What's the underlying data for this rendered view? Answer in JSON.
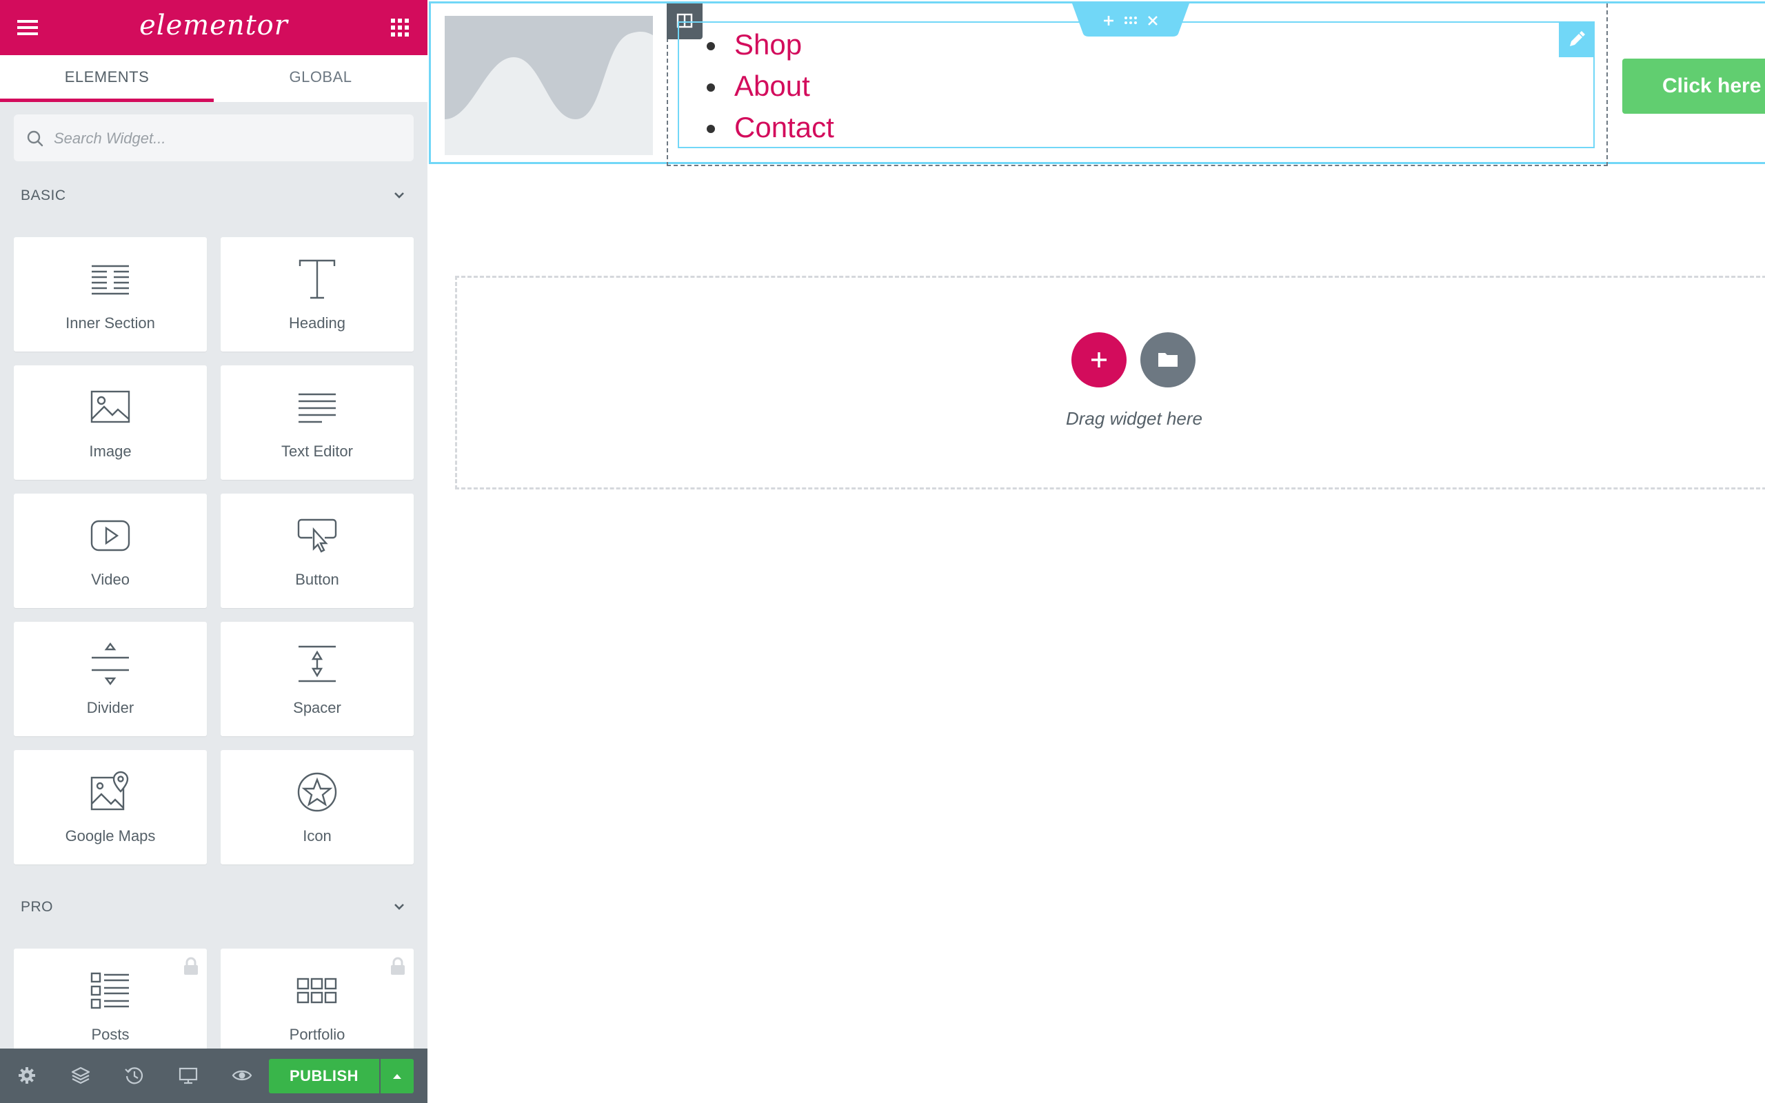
{
  "app": {
    "logo_text": "elementor",
    "brand_color": "#d30c5c",
    "accent_color": "#71d7f7",
    "publish_color": "#39b54a"
  },
  "header_icons": {
    "menu": "hamburger-menu-icon",
    "apps": "apps-grid-icon"
  },
  "tabs": [
    {
      "label": "ELEMENTS",
      "active": true
    },
    {
      "label": "GLOBAL",
      "active": false
    }
  ],
  "search": {
    "placeholder": "Search Widget..."
  },
  "categories": {
    "basic": {
      "title": "BASIC",
      "widgets": [
        {
          "label": "Inner Section",
          "icon": "inner-section-icon"
        },
        {
          "label": "Heading",
          "icon": "heading-icon"
        },
        {
          "label": "Image",
          "icon": "image-icon"
        },
        {
          "label": "Text Editor",
          "icon": "text-editor-icon"
        },
        {
          "label": "Video",
          "icon": "video-icon"
        },
        {
          "label": "Button",
          "icon": "button-icon"
        },
        {
          "label": "Divider",
          "icon": "divider-icon"
        },
        {
          "label": "Spacer",
          "icon": "spacer-icon"
        },
        {
          "label": "Google Maps",
          "icon": "google-maps-icon"
        },
        {
          "label": "Icon",
          "icon": "star-icon"
        }
      ]
    },
    "pro": {
      "title": "PRO",
      "widgets": [
        {
          "label": "Posts",
          "icon": "posts-icon",
          "locked": true
        },
        {
          "label": "Portfolio",
          "icon": "portfolio-icon",
          "locked": true
        }
      ]
    }
  },
  "footer": {
    "publish_label": "PUBLISH",
    "icons": [
      "settings-icon",
      "navigator-layers-icon",
      "history-icon",
      "responsive-desktop-icon",
      "preview-eye-icon"
    ]
  },
  "preview": {
    "nav_items": [
      "Shop",
      "About",
      "Contact"
    ],
    "button_label": "Click here",
    "button_color": "#61ce70",
    "drop_hint": "Drag widget here"
  }
}
